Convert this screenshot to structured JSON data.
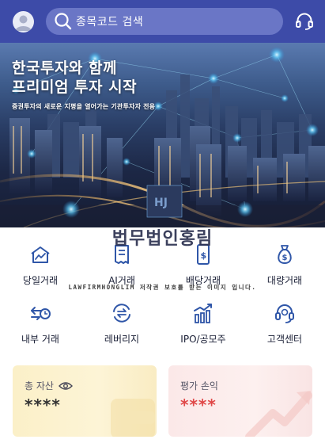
{
  "topbar": {
    "search_placeholder": "종목코드 검색",
    "avatar_icon": "user-avatar-icon",
    "support_icon": "headset-icon",
    "background_color": "#3d4ba8"
  },
  "hero": {
    "title_line1": "한국투자와 함께",
    "title_line2": "프리미엄 투자 시작",
    "subtitle": "증권투자의 새로운 지평을 열어가는 기관투자자 전용"
  },
  "watermark": {
    "main": "법무법인홍림",
    "sub": "LAWFIRMHONGLIM 저작권 보호를 받는 이미지 입니다."
  },
  "menu": [
    {
      "label": "당일거래",
      "icon": "trend-chart-icon"
    },
    {
      "label": "AI거래",
      "icon": "receipt-icon"
    },
    {
      "label": "배당거래",
      "icon": "dividend-phone-icon"
    },
    {
      "label": "대량거래",
      "icon": "money-bag-icon"
    },
    {
      "label": "내부 거래",
      "icon": "clock-transfer-icon"
    },
    {
      "label": "레버리지",
      "icon": "exchange-arrows-icon"
    },
    {
      "label": "IPO/공모주",
      "icon": "bar-growth-icon"
    },
    {
      "label": "고객센터",
      "icon": "customer-service-icon"
    }
  ],
  "cards": {
    "total": {
      "title": "총 자산",
      "value": "****",
      "icon": "eye-icon"
    },
    "pnl": {
      "title": "평가 손익",
      "value": "****"
    }
  },
  "colors": {
    "accent": "#3d4ba8",
    "icon_blue": "#2f56a8",
    "loss_red": "#e04848"
  }
}
